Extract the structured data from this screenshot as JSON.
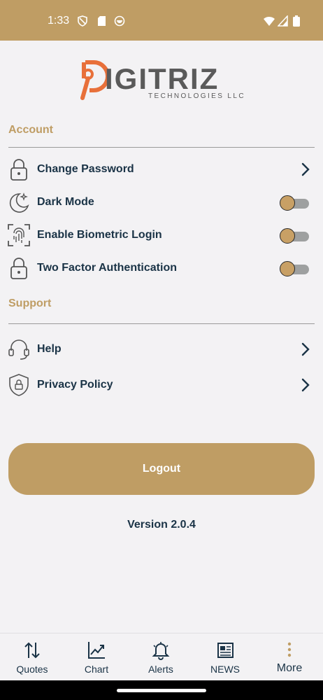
{
  "status_bar": {
    "time": "1:33"
  },
  "brand": {
    "letter": "D",
    "name": "IGITRIZ",
    "tagline": "TECHNOLOGIES LLC",
    "accent_color": "#e8703a",
    "text_color": "#5a5a5a"
  },
  "account": {
    "title": "Account",
    "items": [
      {
        "label": "Change Password",
        "icon": "lock-icon",
        "control": "chevron"
      },
      {
        "label": "Dark Mode",
        "icon": "moon-icon",
        "control": "toggle",
        "on": false
      },
      {
        "label": "Enable Biometric Login",
        "icon": "fingerprint-icon",
        "control": "toggle",
        "on": false
      },
      {
        "label": "Two Factor Authentication",
        "icon": "lock-icon",
        "control": "toggle",
        "on": false
      }
    ]
  },
  "support": {
    "title": "Support",
    "items": [
      {
        "label": "Help",
        "icon": "headset-icon",
        "control": "chevron"
      },
      {
        "label": "Privacy Policy",
        "icon": "shield-lock-icon",
        "control": "chevron"
      }
    ]
  },
  "logout_label": "Logout",
  "version": "Version 2.0.4",
  "bottom_nav": {
    "items": [
      {
        "label": "Quotes",
        "icon": "sort-arrows-icon"
      },
      {
        "label": "Chart",
        "icon": "trend-chart-icon"
      },
      {
        "label": "Alerts",
        "icon": "bell-icon"
      },
      {
        "label": "NEWS",
        "icon": "newspaper-icon"
      },
      {
        "label": "More",
        "icon": "more-vertical-icon"
      }
    ]
  },
  "colors": {
    "primary": "#bf9d64",
    "text_dark": "#1a3346",
    "background": "#f3f2f4"
  }
}
